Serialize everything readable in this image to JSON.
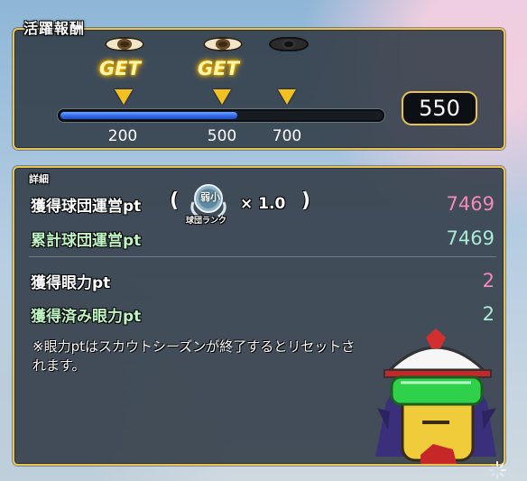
{
  "reward": {
    "title": "活躍報酬",
    "milestones": [
      {
        "threshold": "200",
        "status": "GET"
      },
      {
        "threshold": "500",
        "status": "GET"
      },
      {
        "threshold": "700",
        "status": ""
      }
    ],
    "progress_fraction": 0.55,
    "current_value": "550"
  },
  "detail": {
    "title": "詳細",
    "earned_team_pt_label": "獲得球団運営pt",
    "paren_open": "(",
    "paren_close": ")",
    "rank_badge_name": "弱小",
    "rank_label": "球団ランク",
    "multiplier": "× 1.0",
    "earned_team_pt_value": "7469",
    "total_team_pt_label": "累計球団運営pt",
    "total_team_pt_value": "7469",
    "earned_eye_pt_label": "獲得眼力pt",
    "earned_eye_pt_value": "2",
    "acquired_eye_pt_label": "獲得済み眼力pt",
    "acquired_eye_pt_value": "2",
    "note": "※眼力ptはスカウトシーズンが終了するとリセットされます。"
  },
  "colors": {
    "border_gold": "#e9c250",
    "progress_blue": "#2f64e8",
    "value_pink": "#f48ab8",
    "value_mint": "#a8ecd2"
  },
  "icons": [
    "eye-icon",
    "marker-triangle-icon",
    "rank-wreath-icon",
    "loading-icon"
  ]
}
